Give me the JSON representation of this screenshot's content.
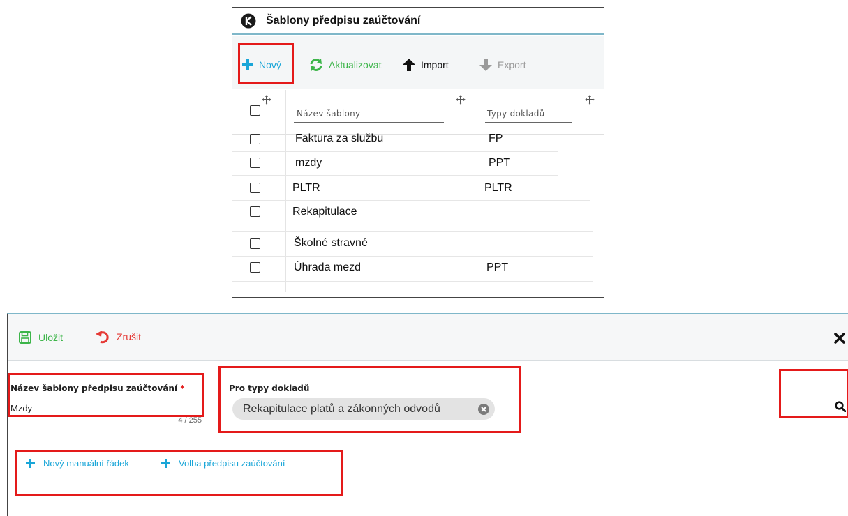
{
  "list_panel": {
    "title": "Šablony předpisu zaúčtování",
    "toolbar": {
      "new_label": "Nový",
      "refresh_label": "Aktualizovat",
      "import_label": "Import",
      "export_label": "Export"
    },
    "columns": [
      "Název šablony",
      "Typy dokladů"
    ],
    "rows": [
      {
        "name": "Faktura za službu",
        "types": "FP"
      },
      {
        "name": "mzdy",
        "types": "PPT"
      },
      {
        "name": "PLTR",
        "types": "PLTR"
      },
      {
        "name": "Rekapitulace",
        "types": ""
      },
      {
        "name": "Školné stravné",
        "types": ""
      },
      {
        "name": "Úhrada mezd",
        "types": "PPT"
      }
    ]
  },
  "editor": {
    "toolbar": {
      "save_label": "Uložit",
      "cancel_label": "Zrušit"
    },
    "name_field": {
      "label": "Název šablony předpisu zaúčtování",
      "required_mark": "*",
      "value": "Mzdy",
      "counter": "4 / 255"
    },
    "doc_types_field": {
      "label": "Pro typy dokladů",
      "selected": [
        "Rekapitulace platů a zákonných odvodů"
      ]
    },
    "actions": {
      "new_manual_line_label": "Nový manuální řádek",
      "select_rule_label": "Volba předpisu zaúčtování"
    }
  },
  "colors": {
    "accent_blue": "#1aa6d8",
    "accent_green": "#3db54a",
    "danger_red": "#e53935",
    "highlight_box": "#e41a1a"
  },
  "icons": [
    "app-logo-icon",
    "plus-icon",
    "refresh-icon",
    "arrow-up-icon",
    "arrow-down-icon",
    "move-icon",
    "save-icon",
    "undo-icon",
    "close-icon",
    "chip-remove-icon",
    "search-icon"
  ]
}
